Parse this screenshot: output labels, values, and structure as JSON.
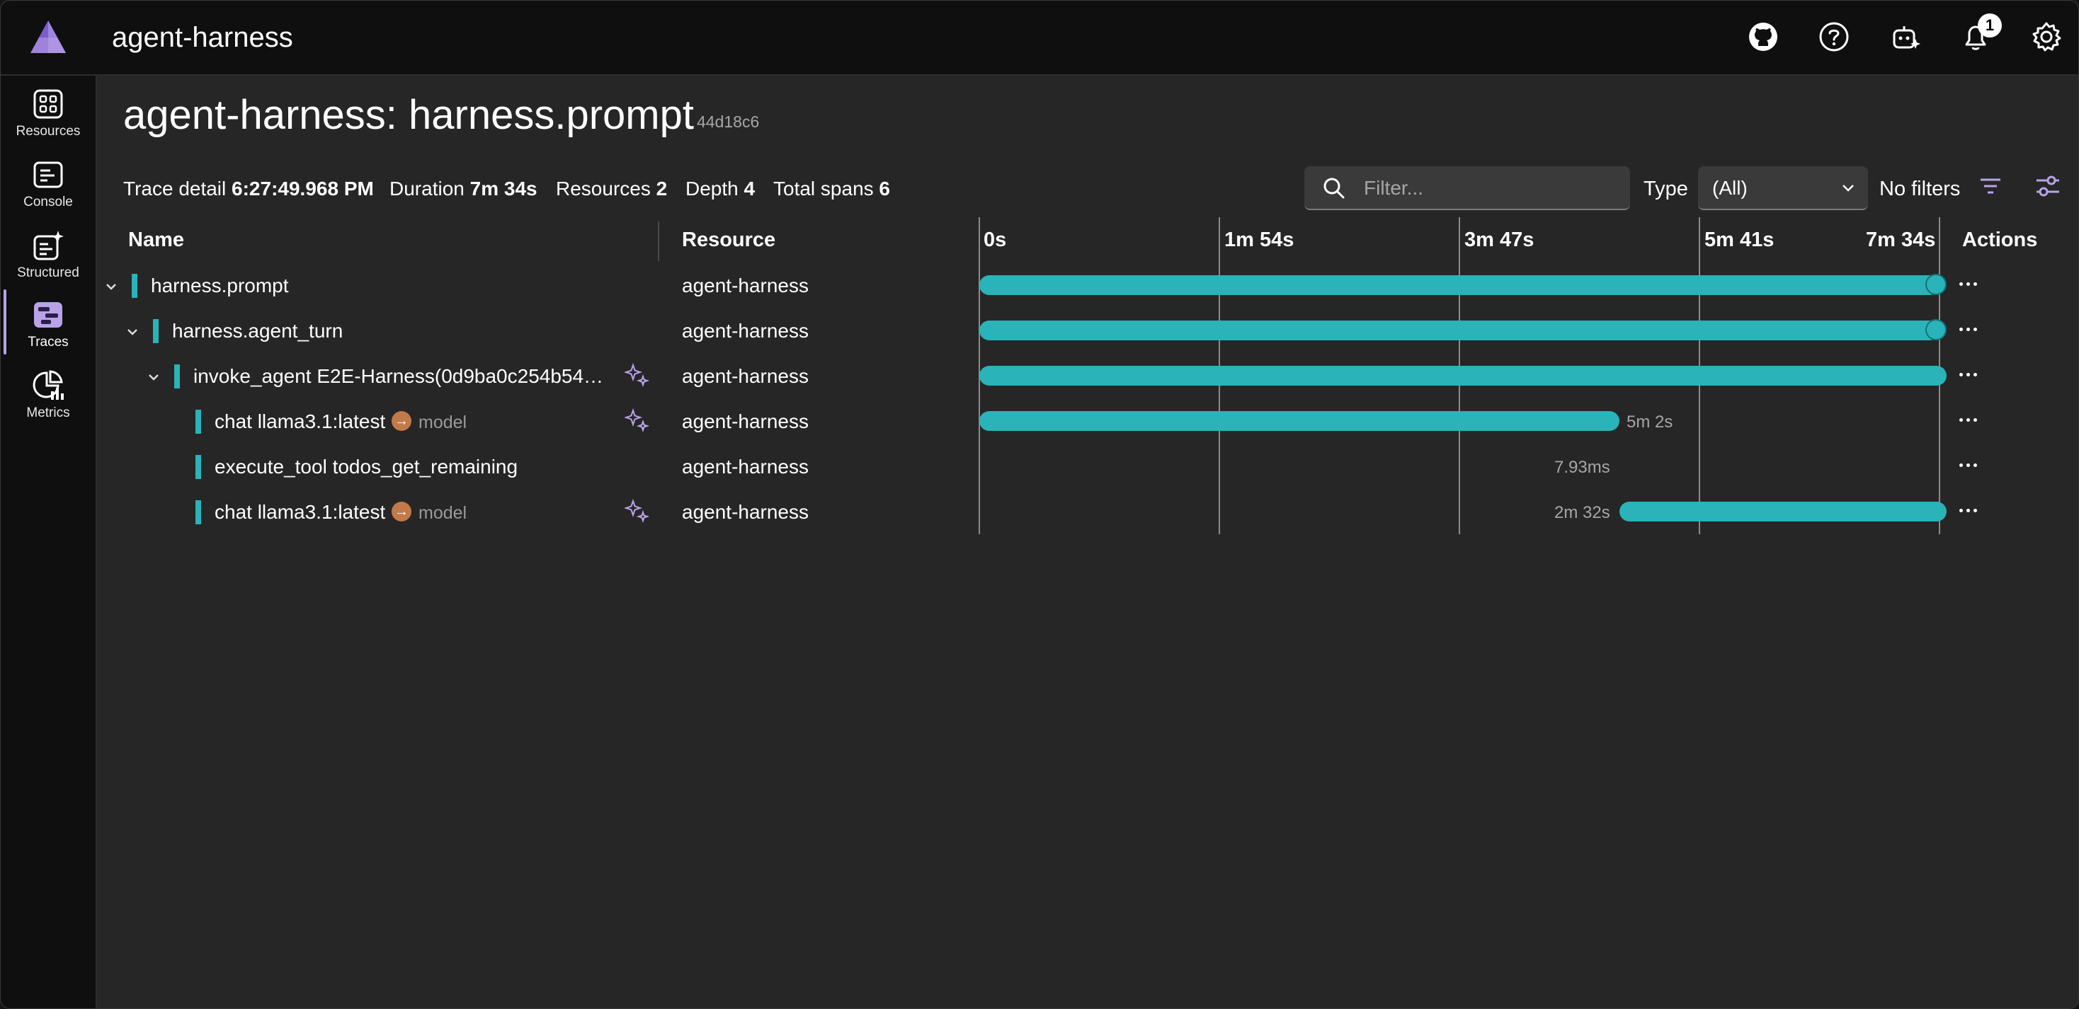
{
  "app": {
    "title": "agent-harness",
    "notification_count": "1"
  },
  "sidebar": {
    "items": [
      {
        "label": "Resources",
        "icon": "grid-icon"
      },
      {
        "label": "Console",
        "icon": "console-icon"
      },
      {
        "label": "Structured",
        "icon": "structured-icon"
      },
      {
        "label": "Traces",
        "icon": "traces-icon",
        "active": true
      },
      {
        "label": "Metrics",
        "icon": "metrics-icon"
      }
    ]
  },
  "page": {
    "title": "agent-harness: harness.prompt",
    "trace_id": "44d18c6"
  },
  "meta": {
    "trace_detail_label": "Trace detail",
    "trace_detail_value": "6:27:49.968 PM",
    "duration_label": "Duration",
    "duration_value": "7m 34s",
    "resources_label": "Resources",
    "resources_value": "2",
    "depth_label": "Depth",
    "depth_value": "4",
    "total_spans_label": "Total spans",
    "total_spans_value": "6"
  },
  "toolbar": {
    "filter_placeholder": "Filter...",
    "type_label": "Type",
    "type_value": "(All)",
    "no_filters": "No filters"
  },
  "grid": {
    "col_name": "Name",
    "col_resource": "Resource",
    "col_actions": "Actions",
    "ticks": [
      "0s",
      "1m 54s",
      "3m 47s",
      "5m 41s",
      "7m 34s"
    ]
  },
  "spans": [
    {
      "name": "harness.prompt",
      "resource": "agent-harness",
      "depth": 0,
      "expandable": true
    },
    {
      "name": "harness.agent_turn",
      "resource": "agent-harness",
      "depth": 1,
      "expandable": true
    },
    {
      "name": "invoke_agent E2E-Harness(0d9ba0c254b54…",
      "resource": "agent-harness",
      "depth": 2,
      "expandable": true,
      "sparkle": true
    },
    {
      "name": "chat llama3.1:latest",
      "resource": "agent-harness",
      "depth": 3,
      "model_label": "model",
      "sparkle": true,
      "duration_label": "5m 2s"
    },
    {
      "name": "execute_tool todos_get_remaining",
      "resource": "agent-harness",
      "depth": 3,
      "duration_label": "7.93ms"
    },
    {
      "name": "chat llama3.1:latest",
      "resource": "agent-harness",
      "depth": 3,
      "model_label": "model",
      "sparkle": true,
      "duration_label": "2m 32s"
    }
  ],
  "colors": {
    "bar": "#2ab3b8",
    "accent": "#b9a3e8",
    "model_dot": "#c27a49"
  }
}
